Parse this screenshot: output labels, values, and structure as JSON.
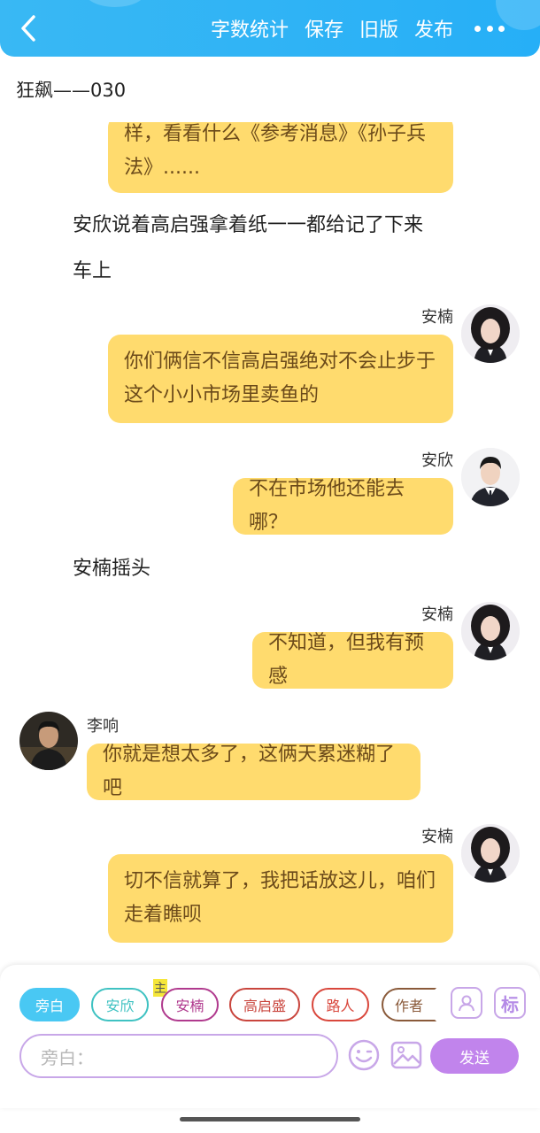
{
  "header": {
    "actions": [
      "字数统计",
      "保存",
      "旧版",
      "发布"
    ]
  },
  "chapter": {
    "title": "狂飙——030"
  },
  "messages": {
    "m0": {
      "line1": "样，看看什么《参考消息》《孙子兵",
      "line2": "法》......"
    },
    "n1": "安欣说着高启强拿着纸一一都给记了下来",
    "n2": "车上",
    "m1": {
      "speaker": "安楠",
      "line1": "你们俩信不信高启强绝对不会止步于",
      "line2": "这个小小市场里卖鱼的"
    },
    "m2": {
      "speaker": "安欣",
      "text": "不在市场他还能去哪？"
    },
    "n3": "安楠摇头",
    "m3": {
      "speaker": "安楠",
      "text": "不知道，但我有预感"
    },
    "m4": {
      "speaker": "李响",
      "text": "你就是想太多了，这俩天累迷糊了吧"
    },
    "m5": {
      "speaker": "安楠",
      "line1": "切不信就算了，我把话放这儿，咱们",
      "line2": "走着瞧呗"
    }
  },
  "composer": {
    "roles": [
      {
        "label": "旁白",
        "color": "#49c8f3"
      },
      {
        "label": "安欣",
        "color": "#3fc2c2"
      },
      {
        "label": "安楠",
        "color": "#b03a8e"
      },
      {
        "label": "高启盛",
        "color": "#c9453d"
      },
      {
        "label": "路人",
        "color": "#d9473c"
      },
      {
        "label": "作者",
        "color": "#8a5a3a"
      }
    ],
    "main_tag": "主",
    "label_icon_text": "标",
    "input_placeholder": "旁白：",
    "send_label": "发送"
  },
  "colors": {
    "header": "#2fb3f5",
    "bubble": "#ffdb6e",
    "bubble_text": "#6b4a1a",
    "accent_purple": "#c184ec"
  },
  "icons": [
    "back-arrow-icon",
    "more-dots-icon",
    "role-manage-icon",
    "emoji-icon",
    "image-icon"
  ]
}
